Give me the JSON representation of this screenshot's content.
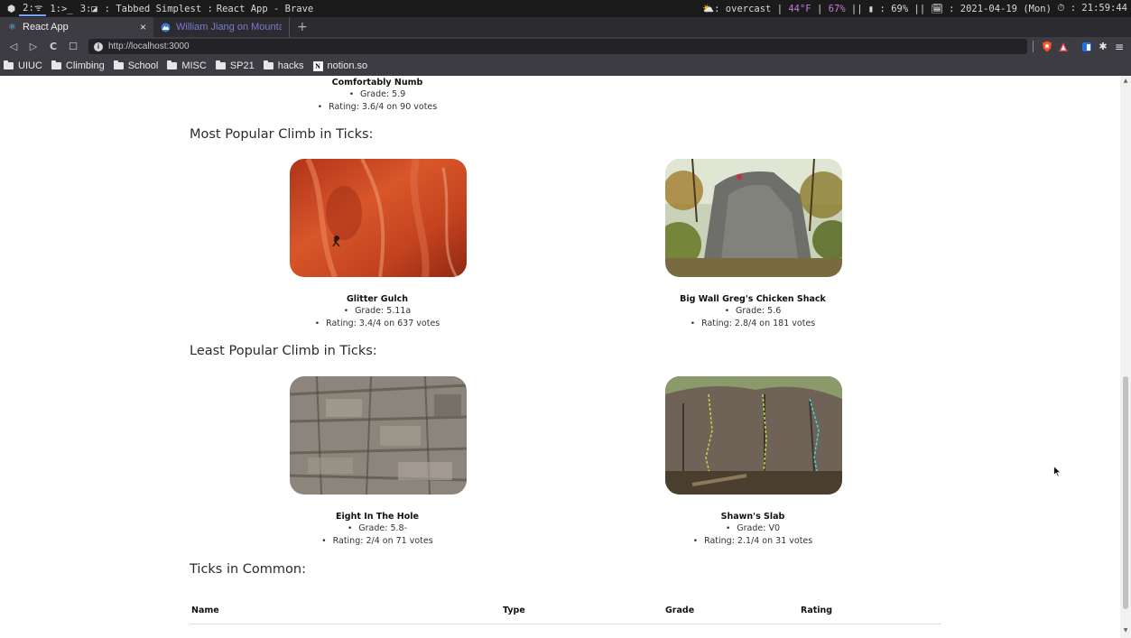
{
  "wm": {
    "workspaces": [
      "2:ᯤ",
      "1:>_",
      "3:◪"
    ],
    "title_prefix": ": Tabbed Simplest :",
    "title_app": "React App - Brave",
    "status": {
      "weather": "⛅: overcast",
      "temp": "44°F",
      "sep1": "|",
      "mem": "67%",
      "sep2": "||",
      "battery": "▮ : 69%",
      "sep3": "||",
      "date": "🗓 : 2021-04-19 (Mon)",
      "time": "⏱ : 21:59:44"
    }
  },
  "tabs": [
    {
      "label": "React App",
      "active": true,
      "close": "×"
    },
    {
      "label": "William Jiang on Mountain Proj",
      "active": false
    }
  ],
  "newtab_label": "+",
  "nav": {
    "back": "◁",
    "forward": "▷",
    "reload": "C",
    "bookmark": "☐",
    "url": "http://localhost:3000",
    "menu": "≡"
  },
  "bookmarks": [
    {
      "label": "UIUC",
      "icon": "folder-icon"
    },
    {
      "label": "Climbing",
      "icon": "folder-icon"
    },
    {
      "label": "School",
      "icon": "folder-icon"
    },
    {
      "label": "MISC",
      "icon": "folder-icon"
    },
    {
      "label": "SP21",
      "icon": "folder-icon"
    },
    {
      "label": "hacks",
      "icon": "folder-icon"
    },
    {
      "label": "notion.so",
      "icon": "notion-icon"
    }
  ],
  "page": {
    "top_climb": {
      "name": "Comfortably Numb",
      "grade": "Grade: 5.9",
      "rating": "Rating: 3.6/4 on 90 votes"
    },
    "most_popular_title": "Most Popular Climb in Ticks:",
    "most_popular": [
      {
        "name": "Glitter Gulch",
        "grade": "Grade: 5.11a",
        "rating": "Rating: 3.4/4 on 637 votes"
      },
      {
        "name": "Big Wall Greg's Chicken Shack",
        "grade": "Grade: 5.6",
        "rating": "Rating: 2.8/4 on 181 votes"
      }
    ],
    "least_popular_title": "Least Popular Climb in Ticks:",
    "least_popular": [
      {
        "name": "Eight In The Hole",
        "grade": "Grade: 5.8-",
        "rating": "Rating: 2/4 on 71 votes"
      },
      {
        "name": "Shawn's Slab",
        "grade": "Grade: V0",
        "rating": "Rating: 2.1/4 on 31 votes"
      }
    ],
    "ticks_title": "Ticks in Common:",
    "table": {
      "headers": [
        "Name",
        "Type",
        "Grade",
        "Rating"
      ]
    }
  }
}
